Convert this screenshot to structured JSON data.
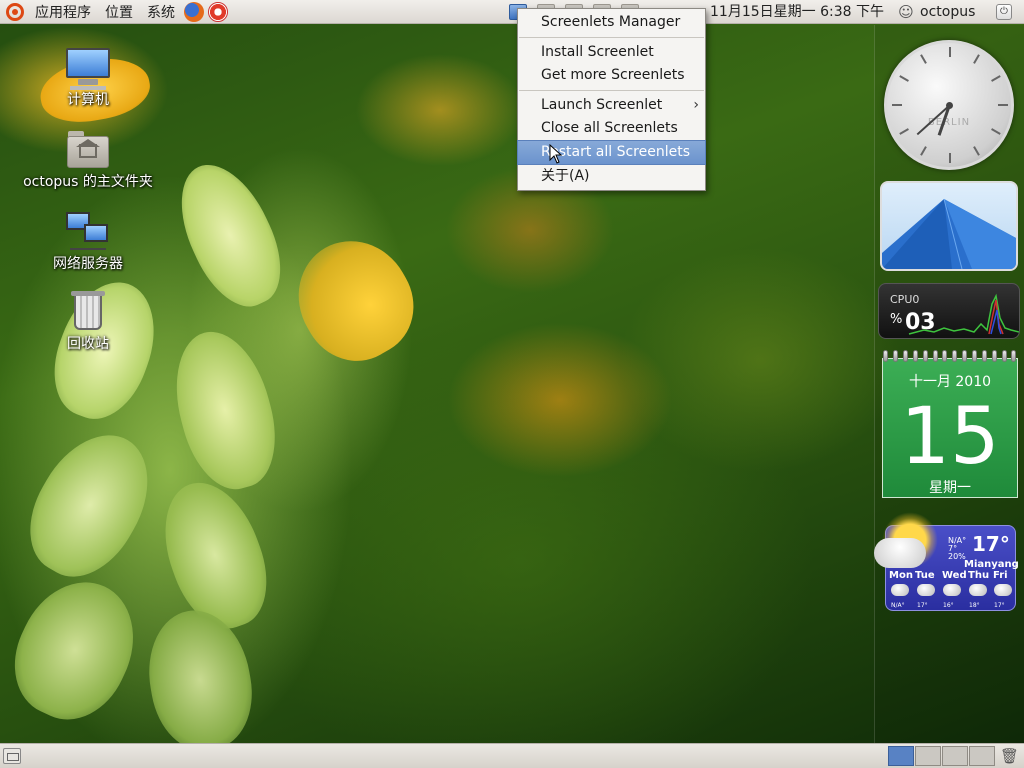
{
  "top_panel": {
    "menus": [
      "应用程序",
      "位置",
      "系统"
    ],
    "launchers": [
      "firefox-icon",
      "help-icon"
    ],
    "clock": "11月15日星期一  6:38 下午",
    "user": "octopus"
  },
  "desktop_icons": [
    {
      "label": "计算机",
      "icon": "computer-icon"
    },
    {
      "label": "octopus 的主文件夹",
      "icon": "home-folder-icon"
    },
    {
      "label": "网络服务器",
      "icon": "network-servers-icon"
    },
    {
      "label": "回收站",
      "icon": "trash-icon"
    }
  ],
  "screenlets_menu": {
    "items": [
      {
        "label": "Screenlets Manager"
      },
      {
        "separator": true
      },
      {
        "label": "Install Screenlet"
      },
      {
        "label": "Get more Screenlets"
      },
      {
        "separator": true
      },
      {
        "label": "Launch Screenlet",
        "submenu": true
      },
      {
        "label": "Close all Screenlets"
      },
      {
        "label": "Restart all Screenlets",
        "highlighted": true
      },
      {
        "label": "关于(A)"
      }
    ],
    "submenu_arrow": "›"
  },
  "widgets": {
    "clock": {
      "city": "BERLIN",
      "hour": 6,
      "minute": 38
    },
    "cpu": {
      "label": "CPU0",
      "percent_sign": "%",
      "value": "03"
    },
    "calendar": {
      "month": "十一月 2010",
      "day": "15",
      "weekday": "星期一"
    },
    "weather": {
      "temperature": "17°",
      "small_lines": [
        "N/A°",
        "7°",
        "20%"
      ],
      "city": "Mianyang",
      "forecast": [
        {
          "day": "Mon",
          "temp": "N/A°"
        },
        {
          "day": "Tue",
          "temp": "17°"
        },
        {
          "day": "Wed",
          "temp": "16°"
        },
        {
          "day": "Thu",
          "temp": "18°"
        },
        {
          "day": "Fri",
          "temp": "17°"
        }
      ]
    }
  },
  "bottom_panel": {
    "workspaces": 4,
    "active_workspace": 1
  },
  "colors": {
    "menu_highlight": "#6b93cd",
    "calendar_green": "#2f9e48",
    "weather_blue": "#3a3fb8",
    "ubuntu_orange": "#dd4814"
  }
}
